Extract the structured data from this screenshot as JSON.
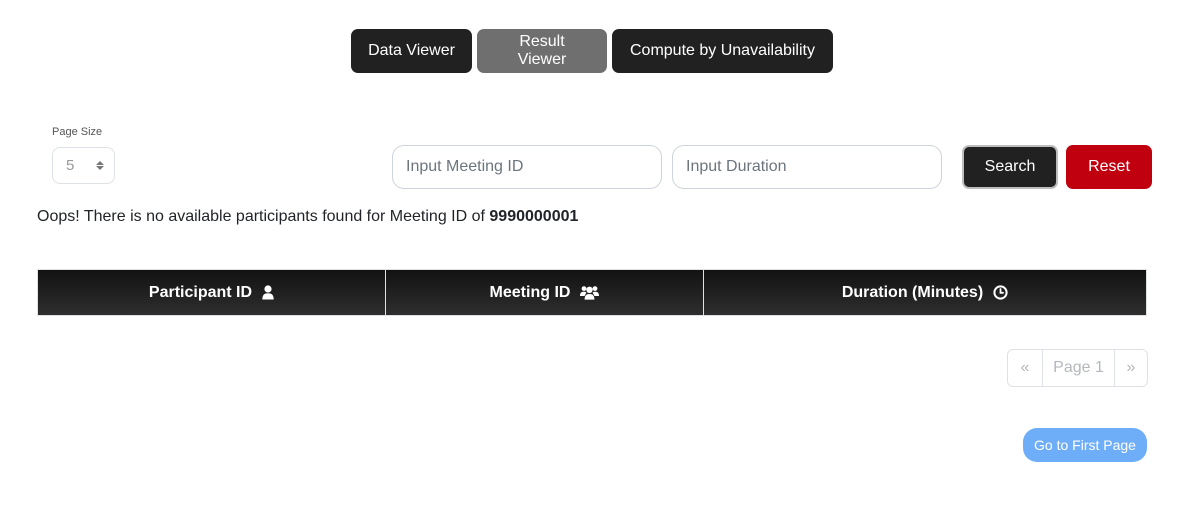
{
  "nav": {
    "data_viewer": "Data Viewer",
    "result_viewer": "Result Viewer",
    "compute": "Compute by Unavailability"
  },
  "page_size": {
    "label": "Page Size",
    "value": "5"
  },
  "inputs": {
    "meeting_placeholder": "Input Meeting ID",
    "duration_placeholder": "Input Duration"
  },
  "buttons": {
    "search": "Search",
    "reset": "Reset",
    "first_page": "Go to First Page"
  },
  "message": {
    "text": "Oops! There is no available participants found for Meeting ID of ",
    "meeting_id": "9990000001"
  },
  "table": {
    "headers": [
      {
        "label": "Participant ID",
        "icon": "user-icon"
      },
      {
        "label": "Meeting ID",
        "icon": "users-icon"
      },
      {
        "label": "Duration (Minutes)",
        "icon": "clock-icon"
      }
    ]
  },
  "pagination": {
    "prev": "«",
    "current": "Page 1",
    "next": "»"
  },
  "colors": {
    "dark": "#212121",
    "active": "#6f6f6f",
    "reset": "#c0000f",
    "first_page": "#6eaef8"
  }
}
